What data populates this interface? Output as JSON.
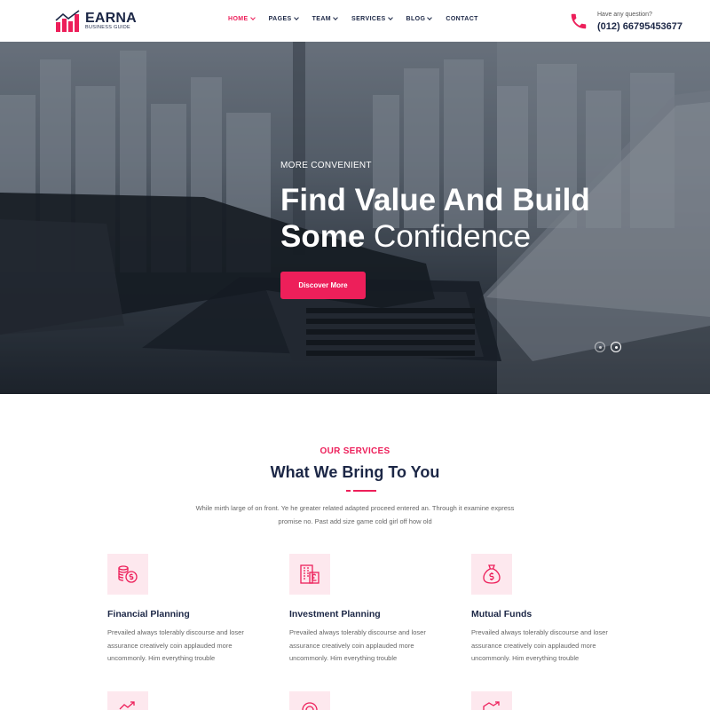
{
  "header": {
    "logo": {
      "name": "EARNA",
      "tagline": "BUSINESS GUIDE"
    },
    "nav": [
      {
        "label": "HOME",
        "dropdown": true,
        "active": true
      },
      {
        "label": "PAGES",
        "dropdown": true,
        "active": false
      },
      {
        "label": "TEAM",
        "dropdown": true,
        "active": false
      },
      {
        "label": "SERVICES",
        "dropdown": true,
        "active": false
      },
      {
        "label": "BLOG",
        "dropdown": true,
        "active": false
      },
      {
        "label": "CONTACT",
        "dropdown": false,
        "active": false
      }
    ],
    "contact": {
      "question": "Have any question?",
      "phone": "(012) 66795453677",
      "icon": "phone-icon"
    }
  },
  "hero": {
    "subtitle": "MORE CONVENIENT",
    "title_line1": "Find Value And Build",
    "title_bold": "Some",
    "title_light": "Confidence",
    "button": "Discover More",
    "slides": 2,
    "active_slide": 2
  },
  "services": {
    "label": "OUR SERVICES",
    "title": "What We Bring To You",
    "description": "While mirth large of on front. Ye he greater related adapted proceed entered an. Through it examine express promise no. Past add size game cold girl off how old",
    "items": [
      {
        "title": "Financial Planning",
        "icon": "coins-dollar-icon",
        "text": "Prevailed always tolerably discourse and loser assurance creatively coin applauded more uncommonly. Him everything trouble"
      },
      {
        "title": "Investment Planning",
        "icon": "building-pound-icon",
        "text": "Prevailed always tolerably discourse and loser assurance creatively coin applauded more uncommonly. Him everything trouble"
      },
      {
        "title": "Mutual Funds",
        "icon": "money-bag-icon",
        "text": "Prevailed always tolerably discourse and loser assurance creatively coin applauded more uncommonly. Him everything trouble"
      }
    ]
  },
  "colors": {
    "accent": "#ed1f5a",
    "navy": "#1c2746",
    "icon_bg": "#fde8ee"
  }
}
